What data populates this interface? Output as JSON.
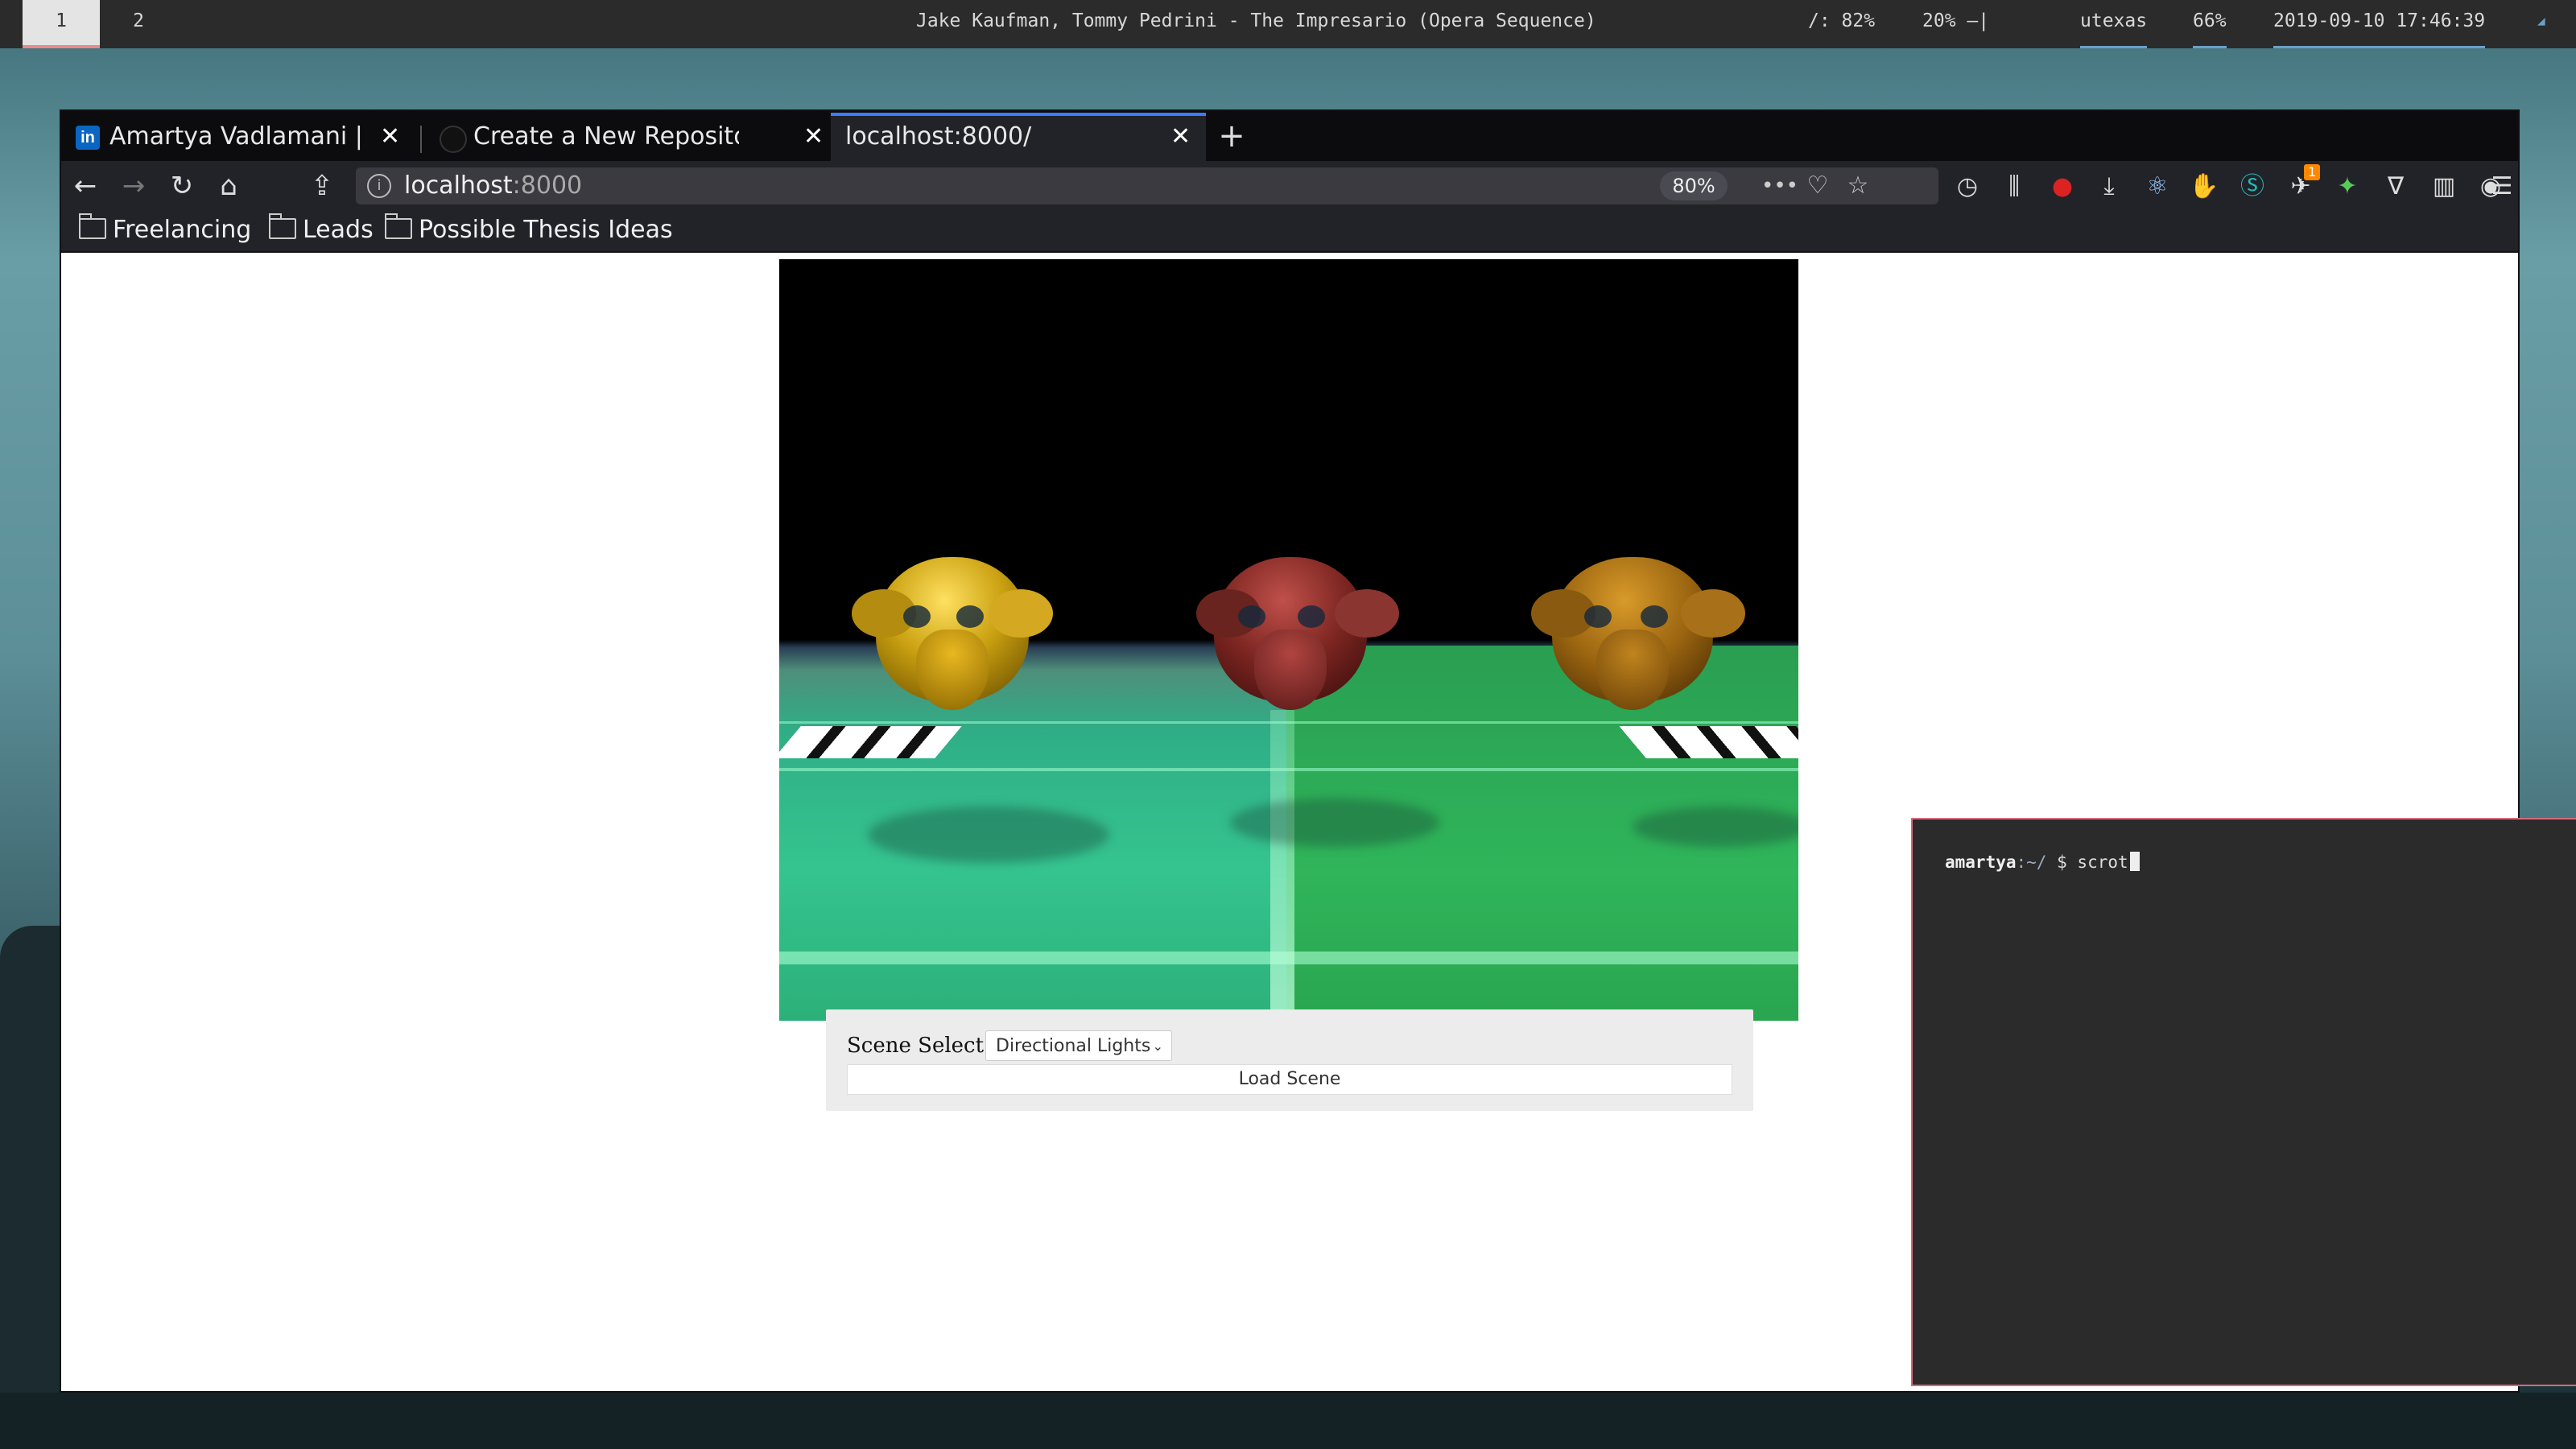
{
  "topbar": {
    "workspaces": [
      "1",
      "2"
    ],
    "now_playing": "Jake Kaufman, Tommy Pedrini - The Impresario (Opera Sequence)",
    "disk": "/: 82%",
    "volume": "20% —|",
    "wifi": "utexas",
    "battery": "66%",
    "datetime": "2019-09-10 17:46:39"
  },
  "browser": {
    "tabs": [
      {
        "label": "Amartya Vadlamani | LinkedIn",
        "icon": "linkedin-icon"
      },
      {
        "label": "Create a New Repository",
        "icon": "github-icon"
      },
      {
        "label": "localhost:8000/",
        "icon": "none"
      }
    ],
    "url_host": "localhost",
    "url_port": ":8000",
    "zoom": "80%",
    "bookmarks": [
      "Freelancing",
      "Leads",
      "Possible Thesis Ideas"
    ],
    "extensions": [
      "history-icon",
      "library-icon",
      "ublock-icon",
      "download-icon",
      "react-icon",
      "gnome-icon",
      "s-icon",
      "badge-ext-icon",
      "fox-icon",
      "vue-icon",
      "grid-icon",
      "account-icon",
      "menu-icon"
    ],
    "extension_badge": "1"
  },
  "page": {
    "scene_label": "Scene Select",
    "scene_selected": "Directional Lights",
    "load_button": "Load Scene"
  },
  "terminal": {
    "user": "amartya",
    "path": ":~/",
    "prompt": "$",
    "command": "scrot"
  },
  "colors": {
    "topbar_bg": "#2b2b2b",
    "browser_chrome": "#222229",
    "active_tab_accent": "#3b7cff",
    "terminal_border": "#d66a7a"
  }
}
